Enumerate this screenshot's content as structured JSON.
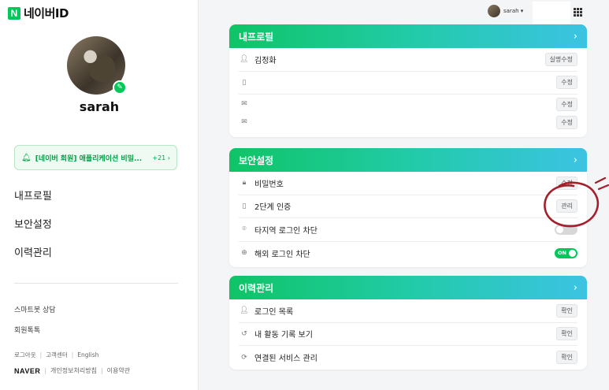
{
  "logo": {
    "mark": "N",
    "text": "네이버ID"
  },
  "sidebar": {
    "username": "sarah",
    "notice": {
      "message": "[네이버 회원] 애플리케이션 비밀...",
      "count": "+21 ›"
    },
    "menu": [
      "내프로필",
      "보안설정",
      "이력관리"
    ],
    "sub_links": [
      "스마트봇 상담",
      "회원톡톡"
    ],
    "footer_links": [
      "로그아웃",
      "고객센터",
      "English"
    ],
    "footer_brand": "NAVER",
    "footer_links2": [
      "개인정보처리방침",
      "이용약관"
    ]
  },
  "topbar": {
    "username": "sarah ▾"
  },
  "profile_card": {
    "title": "내프로필",
    "chevron": "›",
    "rows": [
      {
        "label": "김정화",
        "button": "실명수정",
        "icon": "person-icon"
      },
      {
        "label": "",
        "button": "수정",
        "icon": "phone-icon"
      },
      {
        "label": "",
        "button": "수정",
        "icon": "mail-icon"
      },
      {
        "label": "",
        "button": "수정",
        "icon": "mail-icon"
      }
    ]
  },
  "security_card": {
    "title": "보안설정",
    "chevron": "›",
    "rows": [
      {
        "label": "비밀번호",
        "button": "수정",
        "icon": "lock-icon"
      },
      {
        "label": "2단계 인증",
        "button": "관리",
        "icon": "shield-phone-icon"
      },
      {
        "label": "타지역 로그인 차단",
        "toggle": "",
        "icon": "location-icon"
      },
      {
        "label": "해외 로그인 차단",
        "toggle": "ON",
        "icon": "globe-icon"
      }
    ]
  },
  "history_card": {
    "title": "이력관리",
    "chevron": "›",
    "rows": [
      {
        "label": "로그인 목록",
        "button": "확인",
        "icon": "person-list-icon"
      },
      {
        "label": "내 활동 기록 보기",
        "button": "확인",
        "icon": "history-icon"
      },
      {
        "label": "연결된 서비스 관리",
        "button": "확인",
        "icon": "refresh-icon"
      }
    ]
  },
  "colors": {
    "brand": "#03c75a",
    "gradient_start": "#0fc466",
    "gradient_end": "#3cc3e3",
    "scribble": "#a31f2a"
  }
}
